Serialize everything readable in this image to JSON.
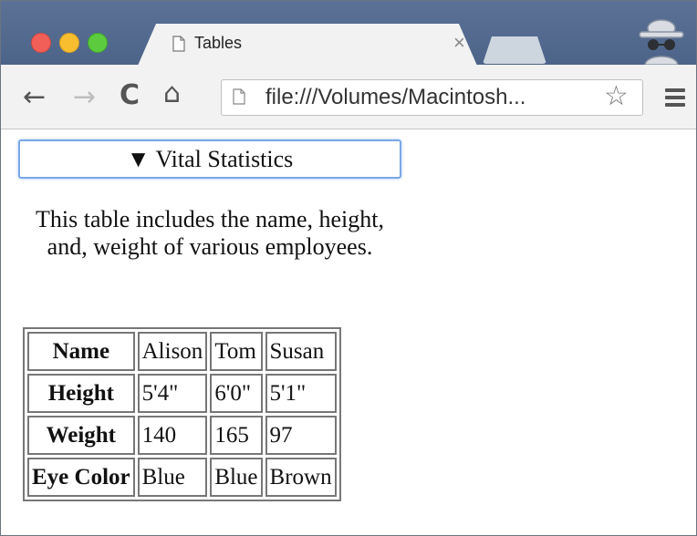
{
  "browser": {
    "tab_title": "Tables",
    "tab_close": "×",
    "url": "file:///Volumes/Macintosh...",
    "nav": {
      "back": "←",
      "forward": "→",
      "reload": "C",
      "home": "⌂",
      "bookmark": "☆"
    }
  },
  "page": {
    "summary_label": "▼ Vital Statistics",
    "description": "This table includes the name, height, and, weight of various employees.",
    "table": {
      "rows": [
        {
          "header": "Name",
          "cells": [
            "Alison",
            "Tom",
            "Susan"
          ]
        },
        {
          "header": "Height",
          "cells": [
            "5'4\"",
            "6'0\"",
            "5'1\""
          ]
        },
        {
          "header": "Weight",
          "cells": [
            "140",
            "165",
            "97"
          ]
        },
        {
          "header": "Eye Color",
          "cells": [
            "Blue",
            "Blue",
            "Brown"
          ]
        }
      ]
    }
  }
}
